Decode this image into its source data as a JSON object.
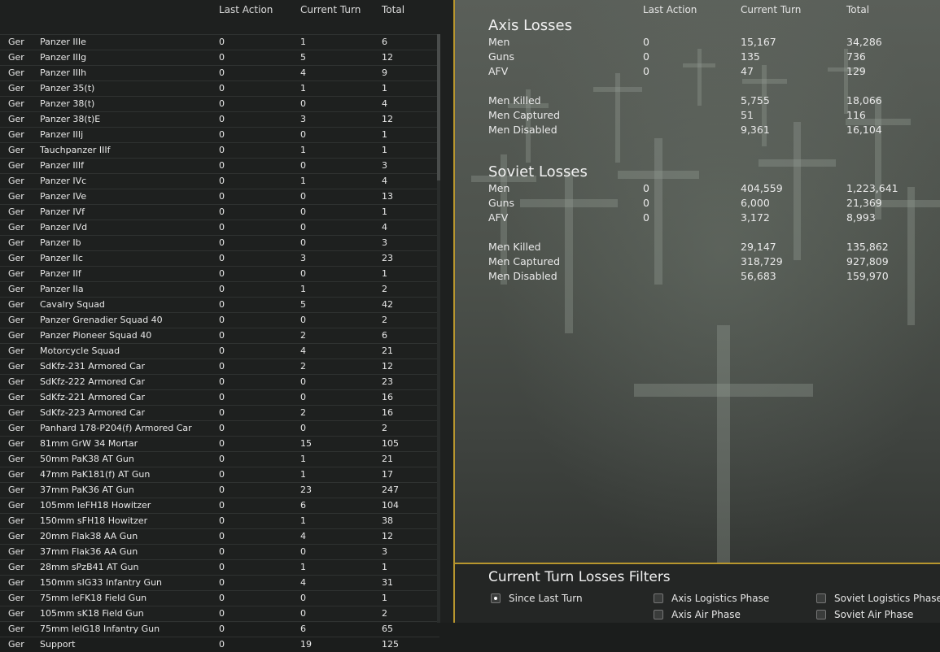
{
  "left": {
    "headers": {
      "last_action": "Last Action",
      "current_turn": "Current Turn",
      "total": "Total"
    },
    "rows": [
      {
        "nat": "Ger",
        "name": "Panzer IIIe",
        "last": "0",
        "cur": "1",
        "total": "6"
      },
      {
        "nat": "Ger",
        "name": "Panzer IIIg",
        "last": "0",
        "cur": "5",
        "total": "12"
      },
      {
        "nat": "Ger",
        "name": "Panzer IIIh",
        "last": "0",
        "cur": "4",
        "total": "9"
      },
      {
        "nat": "Ger",
        "name": "Panzer 35(t)",
        "last": "0",
        "cur": "1",
        "total": "1"
      },
      {
        "nat": "Ger",
        "name": "Panzer 38(t)",
        "last": "0",
        "cur": "0",
        "total": "4"
      },
      {
        "nat": "Ger",
        "name": "Panzer 38(t)E",
        "last": "0",
        "cur": "3",
        "total": "12"
      },
      {
        "nat": "Ger",
        "name": "Panzer IIIj",
        "last": "0",
        "cur": "0",
        "total": "1"
      },
      {
        "nat": "Ger",
        "name": "Tauchpanzer IIIf",
        "last": "0",
        "cur": "1",
        "total": "1"
      },
      {
        "nat": "Ger",
        "name": "Panzer IIIf",
        "last": "0",
        "cur": "0",
        "total": "3"
      },
      {
        "nat": "Ger",
        "name": "Panzer IVc",
        "last": "0",
        "cur": "1",
        "total": "4"
      },
      {
        "nat": "Ger",
        "name": "Panzer IVe",
        "last": "0",
        "cur": "0",
        "total": "13"
      },
      {
        "nat": "Ger",
        "name": "Panzer IVf",
        "last": "0",
        "cur": "0",
        "total": "1"
      },
      {
        "nat": "Ger",
        "name": "Panzer IVd",
        "last": "0",
        "cur": "0",
        "total": "4"
      },
      {
        "nat": "Ger",
        "name": "Panzer Ib",
        "last": "0",
        "cur": "0",
        "total": "3"
      },
      {
        "nat": "Ger",
        "name": "Panzer IIc",
        "last": "0",
        "cur": "3",
        "total": "23"
      },
      {
        "nat": "Ger",
        "name": "Panzer IIf",
        "last": "0",
        "cur": "0",
        "total": "1"
      },
      {
        "nat": "Ger",
        "name": "Panzer IIa",
        "last": "0",
        "cur": "1",
        "total": "2"
      },
      {
        "nat": "Ger",
        "name": "Cavalry Squad",
        "last": "0",
        "cur": "5",
        "total": "42"
      },
      {
        "nat": "Ger",
        "name": "Panzer Grenadier Squad 40",
        "last": "0",
        "cur": "0",
        "total": "2"
      },
      {
        "nat": "Ger",
        "name": "Panzer Pioneer Squad 40",
        "last": "0",
        "cur": "2",
        "total": "6"
      },
      {
        "nat": "Ger",
        "name": "Motorcycle Squad",
        "last": "0",
        "cur": "4",
        "total": "21"
      },
      {
        "nat": "Ger",
        "name": "SdKfz-231 Armored Car",
        "last": "0",
        "cur": "2",
        "total": "12"
      },
      {
        "nat": "Ger",
        "name": "SdKfz-222 Armored Car",
        "last": "0",
        "cur": "0",
        "total": "23"
      },
      {
        "nat": "Ger",
        "name": "SdKfz-221 Armored Car",
        "last": "0",
        "cur": "0",
        "total": "16"
      },
      {
        "nat": "Ger",
        "name": "SdKfz-223 Armored Car",
        "last": "0",
        "cur": "2",
        "total": "16"
      },
      {
        "nat": "Ger",
        "name": "Panhard 178-P204(f) Armored Car",
        "last": "0",
        "cur": "0",
        "total": "2"
      },
      {
        "nat": "Ger",
        "name": "81mm GrW 34 Mortar",
        "last": "0",
        "cur": "15",
        "total": "105"
      },
      {
        "nat": "Ger",
        "name": "50mm PaK38 AT Gun",
        "last": "0",
        "cur": "1",
        "total": "21"
      },
      {
        "nat": "Ger",
        "name": "47mm PaK181(f) AT Gun",
        "last": "0",
        "cur": "1",
        "total": "17"
      },
      {
        "nat": "Ger",
        "name": "37mm PaK36 AT Gun",
        "last": "0",
        "cur": "23",
        "total": "247"
      },
      {
        "nat": "Ger",
        "name": "105mm leFH18 Howitzer",
        "last": "0",
        "cur": "6",
        "total": "104"
      },
      {
        "nat": "Ger",
        "name": "150mm sFH18 Howitzer",
        "last": "0",
        "cur": "1",
        "total": "38"
      },
      {
        "nat": "Ger",
        "name": "20mm Flak38 AA Gun",
        "last": "0",
        "cur": "4",
        "total": "12"
      },
      {
        "nat": "Ger",
        "name": "37mm Flak36 AA Gun",
        "last": "0",
        "cur": "0",
        "total": "3"
      },
      {
        "nat": "Ger",
        "name": "28mm sPzB41 AT Gun",
        "last": "0",
        "cur": "1",
        "total": "1"
      },
      {
        "nat": "Ger",
        "name": "150mm sIG33 Infantry Gun",
        "last": "0",
        "cur": "4",
        "total": "31"
      },
      {
        "nat": "Ger",
        "name": "75mm leFK18 Field Gun",
        "last": "0",
        "cur": "0",
        "total": "1"
      },
      {
        "nat": "Ger",
        "name": "105mm sK18 Field Gun",
        "last": "0",
        "cur": "0",
        "total": "2"
      },
      {
        "nat": "Ger",
        "name": "75mm leIG18 Infantry Gun",
        "last": "0",
        "cur": "6",
        "total": "65"
      },
      {
        "nat": "Ger",
        "name": "Support",
        "last": "0",
        "cur": "19",
        "total": "125"
      }
    ]
  },
  "right": {
    "headers": {
      "last_action": "Last Action",
      "current_turn": "Current Turn",
      "total": "Total"
    },
    "axis": {
      "title": "Axis Losses",
      "rows": [
        {
          "label": "Men",
          "last": "0",
          "cur": "15,167",
          "total": "34,286"
        },
        {
          "label": "Guns",
          "last": "0",
          "cur": "135",
          "total": "736"
        },
        {
          "label": "AFV",
          "last": "0",
          "cur": "47",
          "total": "129"
        },
        {
          "label": "Men Killed",
          "last": "",
          "cur": "5,755",
          "total": "18,066"
        },
        {
          "label": "Men Captured",
          "last": "",
          "cur": "51",
          "total": "116"
        },
        {
          "label": "Men Disabled",
          "last": "",
          "cur": "9,361",
          "total": "16,104"
        }
      ]
    },
    "soviet": {
      "title": "Soviet Losses",
      "rows": [
        {
          "label": "Men",
          "last": "0",
          "cur": "404,559",
          "total": "1,223,641"
        },
        {
          "label": "Guns",
          "last": "0",
          "cur": "6,000",
          "total": "21,369"
        },
        {
          "label": "AFV",
          "last": "0",
          "cur": "3,172",
          "total": "8,993"
        },
        {
          "label": "Men Killed",
          "last": "",
          "cur": "29,147",
          "total": "135,862"
        },
        {
          "label": "Men Captured",
          "last": "",
          "cur": "318,729",
          "total": "927,809"
        },
        {
          "label": "Men Disabled",
          "last": "",
          "cur": "56,683",
          "total": "159,970"
        }
      ]
    },
    "filters": {
      "title": "Current Turn Losses Filters",
      "options": [
        {
          "label": "Since Last Turn",
          "selected": true
        },
        {
          "label": "Axis Logistics Phase",
          "selected": false
        },
        {
          "label": "Axis Air Phase",
          "selected": false
        },
        {
          "label": "Soviet Logistics Phase",
          "selected": false
        },
        {
          "label": "Soviet Air Phase",
          "selected": false
        }
      ]
    }
  },
  "colors": {
    "accent": "#b8962e",
    "panel": "#1e201f"
  }
}
